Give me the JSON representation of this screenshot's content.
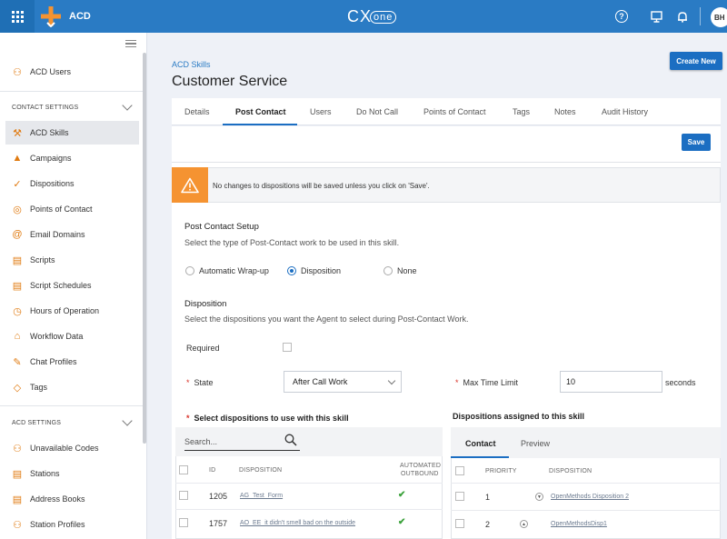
{
  "app": {
    "name": "ACD",
    "brand": "CX",
    "brand_suffix": "one",
    "user_initials": "BH"
  },
  "sidebar": {
    "top_items": [
      {
        "label": "ACD Users",
        "icon": "person-icon"
      }
    ],
    "contact_settings_header": "CONTACT SETTINGS",
    "contact_items": [
      {
        "label": "ACD Skills",
        "icon": "skills-icon",
        "active": true
      },
      {
        "label": "Campaigns",
        "icon": "megaphone-icon"
      },
      {
        "label": "Dispositions",
        "icon": "dispositions-icon"
      },
      {
        "label": "Points of Contact",
        "icon": "compass-icon"
      },
      {
        "label": "Email Domains",
        "icon": "at-icon"
      },
      {
        "label": "Scripts",
        "icon": "script-icon"
      },
      {
        "label": "Script Schedules",
        "icon": "schedule-icon"
      },
      {
        "label": "Hours of Operation",
        "icon": "clock-icon"
      },
      {
        "label": "Workflow Data",
        "icon": "workflow-icon"
      },
      {
        "label": "Chat Profiles",
        "icon": "chat-icon"
      },
      {
        "label": "Tags",
        "icon": "tag-icon"
      }
    ],
    "acd_settings_header": "ACD SETTINGS",
    "acd_items": [
      {
        "label": "Unavailable Codes",
        "icon": "person-icon"
      },
      {
        "label": "Stations",
        "icon": "station-icon"
      },
      {
        "label": "Address Books",
        "icon": "book-icon"
      },
      {
        "label": "Station Profiles",
        "icon": "person-icon"
      }
    ]
  },
  "header": {
    "breadcrumb": "ACD Skills",
    "title": "Customer Service",
    "create_label": "Create New"
  },
  "tabs": [
    "Details",
    "Post Contact",
    "Users",
    "Do Not Call",
    "Points of Contact",
    "Tags",
    "Notes",
    "Audit History"
  ],
  "active_tab": "Post Contact",
  "save_label": "Save",
  "warning": "No changes to dispositions will be saved unless you click on 'Save'.",
  "post_contact": {
    "title": "Post Contact Setup",
    "subtitle": "Select the type of Post-Contact work to be used in this skill.",
    "options": [
      "Automatic Wrap-up",
      "Disposition",
      "None"
    ],
    "selected": "Disposition"
  },
  "disposition": {
    "title": "Disposition",
    "subtitle": "Select the dispositions you want the Agent to select during Post-Contact Work.",
    "required_label": "Required",
    "required_checked": false,
    "state_label": "State",
    "state_value": "After Call Work",
    "max_time_label": "Max Time Limit",
    "max_time_value": "10",
    "max_time_unit": "seconds"
  },
  "left_table": {
    "title": "Select dispositions to use with this skill",
    "search_placeholder": "Search...",
    "headers": {
      "id": "ID",
      "disposition": "DISPOSITION",
      "automated_1": "AUTOMATED",
      "automated_2": "OUTBOUND"
    },
    "rows": [
      {
        "id": "1205",
        "disposition": "AG_Test_Form",
        "automated": true
      },
      {
        "id": "1757",
        "disposition": "AO_EE_it didn't smell bad on the outside",
        "automated": true
      }
    ]
  },
  "right_table": {
    "title": "Dispositions assigned to this skill",
    "tabs": [
      "Contact",
      "Preview"
    ],
    "active_tab": "Contact",
    "headers": {
      "priority": "PRIORITY",
      "disposition": "DISPOSITION"
    },
    "rows": [
      {
        "priority": "1",
        "disposition": "OpenMethods Disposition 2"
      },
      {
        "priority": "2",
        "disposition": "OpenMethodsDisp1"
      }
    ]
  },
  "colors": {
    "topbar": "#2a7bc4",
    "accent": "#1b6ec2",
    "warning": "#f59331",
    "icon": "#e07a10"
  }
}
